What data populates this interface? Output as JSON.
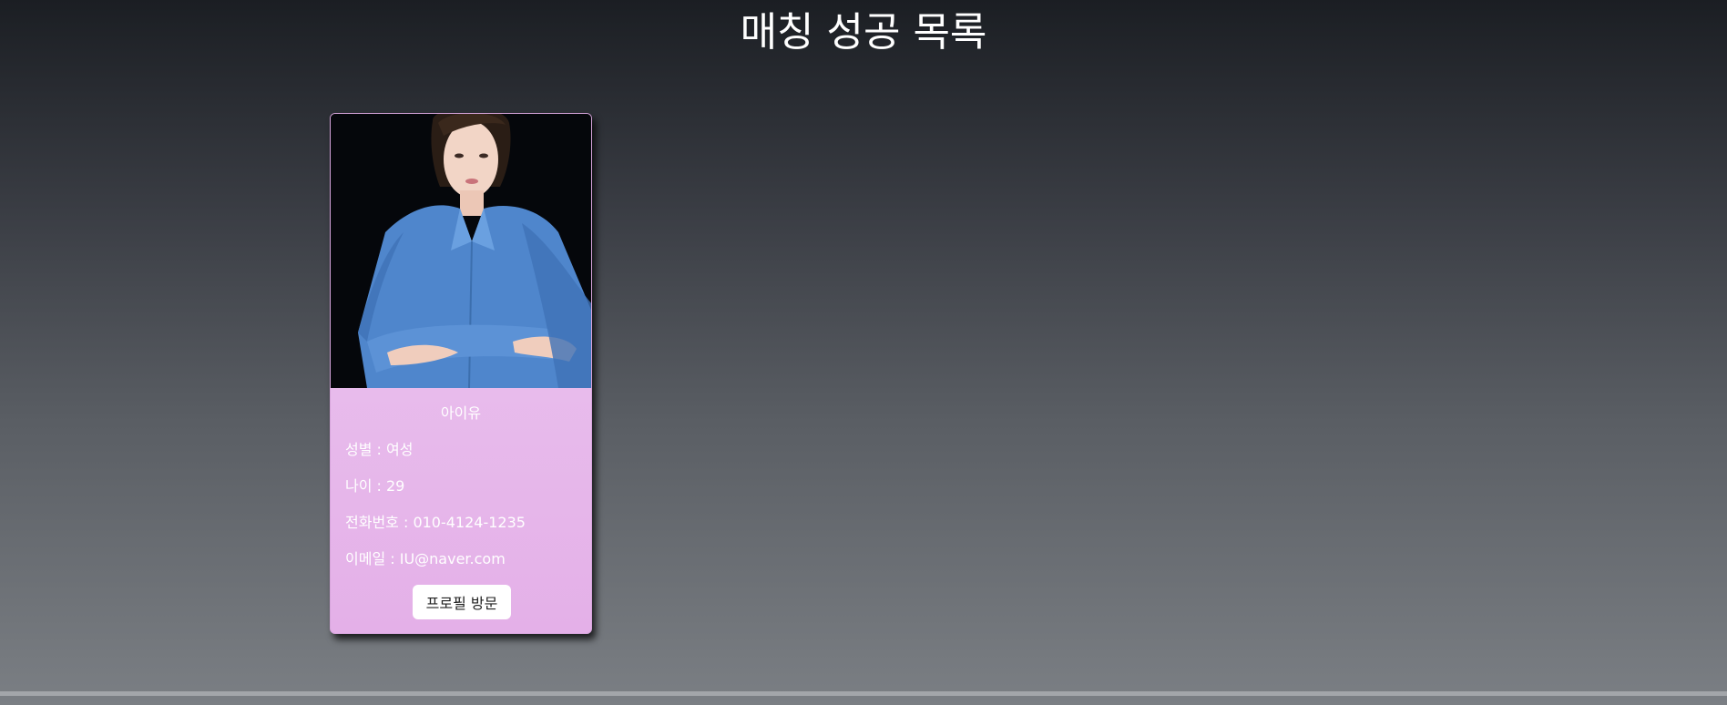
{
  "page": {
    "title": "매칭 성공 목록"
  },
  "matches": [
    {
      "photo": "profile-photo",
      "name": "아이유",
      "gender_label": "성별 : 여성",
      "age_label": "나이 : 29",
      "phone_label": "전화번호 : 010-4124-1235",
      "email_label": "이메일 : IU@naver.com",
      "visit_button": "프로필 방문"
    }
  ],
  "colors": {
    "card_top": "#ecc8f0",
    "card_bottom": "#e4b0e8",
    "page_top": "#1b1e23",
    "page_bottom": "#7b7f84"
  }
}
